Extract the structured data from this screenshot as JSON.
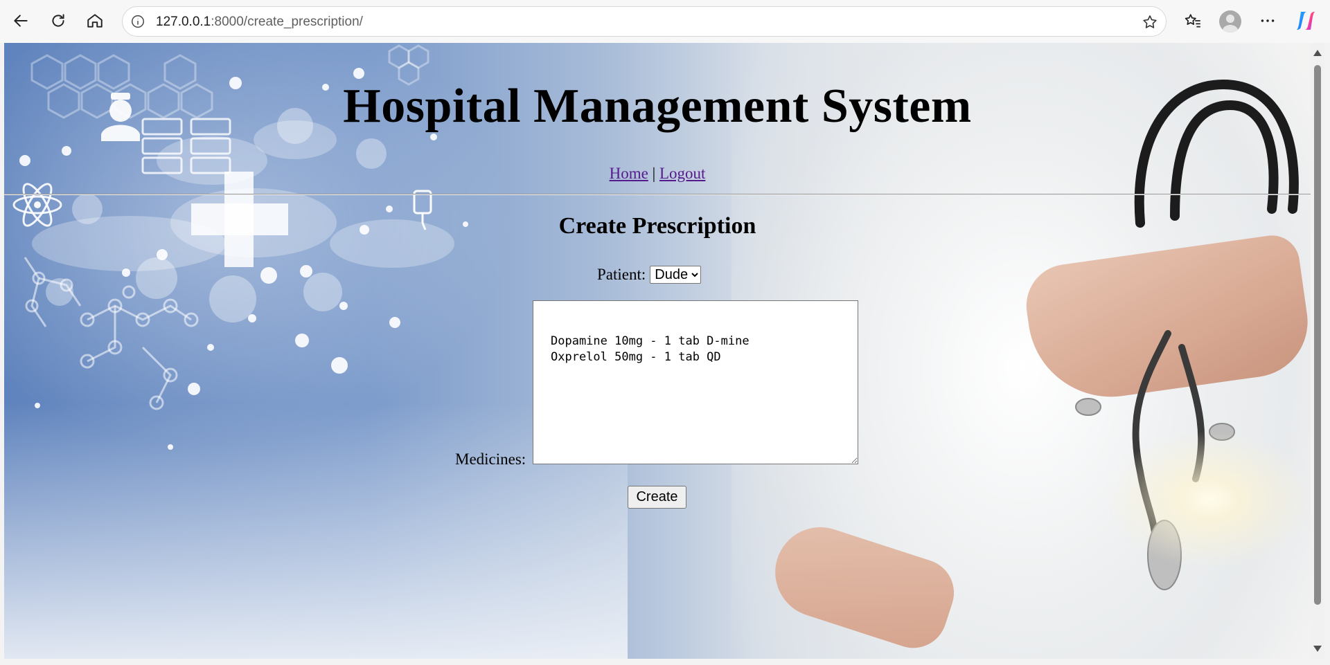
{
  "browser": {
    "url_host": "127.0.0.1",
    "url_rest": ":8000/create_prescription/"
  },
  "page": {
    "title": "Hospital Management System",
    "nav": {
      "home": "Home",
      "separator": "|",
      "logout": "Logout"
    },
    "heading": "Create Prescription",
    "form": {
      "patient_label": "Patient:",
      "patient_selected": "Dude",
      "medicines_label": "Medicines:",
      "medicines_value": "\nDopamine 10mg - 1 tab D-mine\nOxprelol 50mg - 1 tab QD",
      "create_label": "Create"
    }
  },
  "colors": {
    "link_visited": "#551a8b",
    "background_blue": "#5f83bd"
  },
  "icons": [
    "back-arrow-icon",
    "reload-icon",
    "home-icon",
    "site-info-icon",
    "favorite-star-icon",
    "favorites-list-icon",
    "profile-avatar-icon",
    "more-menu-icon",
    "copilot-icon"
  ]
}
